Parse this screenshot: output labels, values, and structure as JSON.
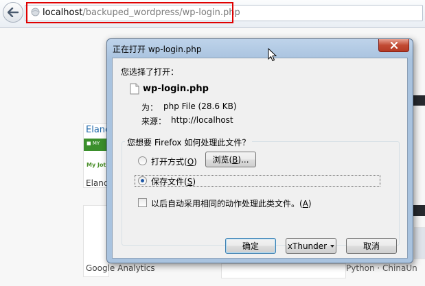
{
  "browser": {
    "url_host": "localhost",
    "url_path": "/backuped_wordpress/wp-login.php"
  },
  "background": {
    "card1_title": "Elanc",
    "card1_green_label": "■ MY",
    "card1_myjob": "My Jot",
    "card1_bottom": "Elanc",
    "bottom_google": "Google Analytics",
    "bottom_python": "Python · ChinaUn"
  },
  "dialog": {
    "title": "正在打开 wp-login.php",
    "chose_to_open": "您选择了打开：",
    "filename": "wp-login.php",
    "type_label": "为：",
    "type_value": "php File (28.6 KB)",
    "from_label": "来源：",
    "from_value": "http://localhost",
    "question": "您想要 Firefox 如何处理此文件？",
    "open_with": "打开方式(",
    "open_with_key": "O",
    "open_with_end": ")",
    "browse": "浏览(",
    "browse_key": "B",
    "browse_end": ")...",
    "save_file": "保存文件(",
    "save_file_key": "S",
    "save_file_end": ")",
    "auto_do": "以后自动采用相同的动作处理此类文件。(",
    "auto_do_key": "A",
    "auto_do_end": ")",
    "ok": "确定",
    "xthunder": "xThunder",
    "cancel": "取消"
  },
  "state": {
    "selected_option": "save_file",
    "auto_checkbox": false
  },
  "icons": {
    "back": "back-arrow-icon",
    "close": "close-icon",
    "file": "file-icon",
    "dropdown": "dropdown-arrow-icon",
    "cursor": "mouse-cursor-icon"
  }
}
